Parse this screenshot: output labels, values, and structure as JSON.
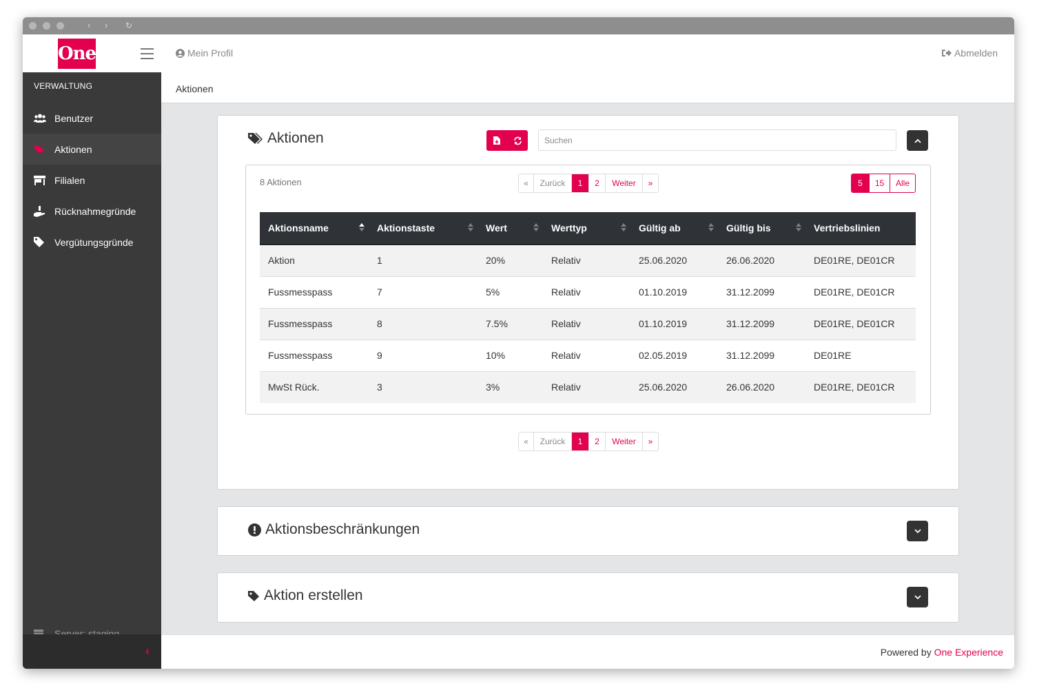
{
  "brand": {
    "logo_text": "One",
    "accent": "#e2004f"
  },
  "header": {
    "profile_label": "Mein Profil",
    "logout_label": "Abmelden"
  },
  "sidebar": {
    "section_title": "VERWALTUNG",
    "items": [
      {
        "label": "Benutzer",
        "icon": "users-icon"
      },
      {
        "label": "Aktionen",
        "icon": "heart-tag-icon"
      },
      {
        "label": "Filialen",
        "icon": "store-icon"
      },
      {
        "label": "Rücknahmegründe",
        "icon": "hand-return-icon"
      },
      {
        "label": "Vergütungsgründe",
        "icon": "tag-icon"
      }
    ],
    "server_label": "Server: staging"
  },
  "breadcrumb": {
    "current": "Aktionen"
  },
  "actions_card": {
    "title": "Aktionen",
    "search_placeholder": "Suchen",
    "count_label": "8 Aktionen",
    "pager": {
      "first": "«",
      "prev": "Zurück",
      "pages": [
        "1",
        "2"
      ],
      "next": "Weiter",
      "last": "»"
    },
    "page_sizes": [
      "5",
      "15",
      "Alle"
    ],
    "columns": [
      "Aktionsname",
      "Aktionstaste",
      "Wert",
      "Werttyp",
      "Gültig ab",
      "Gültig bis",
      "Vertriebslinien"
    ],
    "rows": [
      [
        "Aktion",
        "1",
        "20%",
        "Relativ",
        "25.06.2020",
        "26.06.2020",
        "DE01RE, DE01CR"
      ],
      [
        "Fussmesspass",
        "7",
        "5%",
        "Relativ",
        "01.10.2019",
        "31.12.2099",
        "DE01RE, DE01CR"
      ],
      [
        "Fussmesspass",
        "8",
        "7.5%",
        "Relativ",
        "01.10.2019",
        "31.12.2099",
        "DE01RE, DE01CR"
      ],
      [
        "Fussmesspass",
        "9",
        "10%",
        "Relativ",
        "02.05.2019",
        "31.12.2099",
        "DE01RE"
      ],
      [
        "MwSt Rück.",
        "3",
        "3%",
        "Relativ",
        "25.06.2020",
        "26.06.2020",
        "DE01RE, DE01CR"
      ]
    ]
  },
  "restrictions_card": {
    "title": "Aktionsbeschränkungen"
  },
  "create_card": {
    "title": "Aktion erstellen"
  },
  "footer": {
    "prefix": "Powered by ",
    "brand": "One Experience"
  }
}
